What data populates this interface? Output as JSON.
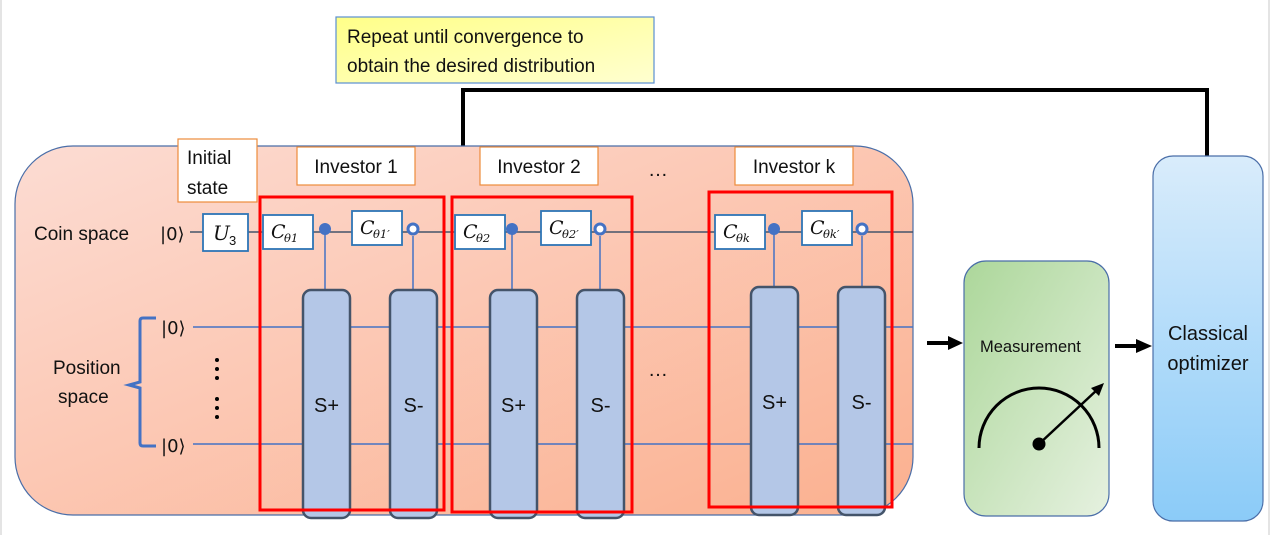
{
  "note": {
    "line1": "Repeat until convergence to",
    "line2": "obtain the desired distribution"
  },
  "labels": {
    "initial_state_1": "Initial",
    "initial_state_2": "state",
    "coin_space": "Coin space",
    "position_space_1": "Position",
    "position_space_2": "space",
    "ket_zero": "|0⟩",
    "ellipsis": "…",
    "vdots": "⋮"
  },
  "initial_gate": {
    "main": "U",
    "sub": "3"
  },
  "investors": [
    {
      "label": "Investor 1",
      "gate_a": {
        "main": "C",
        "sub": "θ1"
      },
      "gate_b": {
        "main": "C",
        "sub": "θ1′"
      },
      "shift_plus": "S+",
      "shift_minus": "S-"
    },
    {
      "label": "Investor 2",
      "gate_a": {
        "main": "C",
        "sub": "θ2"
      },
      "gate_b": {
        "main": "C",
        "sub": "θ2′"
      },
      "shift_plus": "S+",
      "shift_minus": "S-"
    },
    {
      "label": "Investor k",
      "gate_a": {
        "main": "C",
        "sub": "θk"
      },
      "gate_b": {
        "main": "C",
        "sub": "θk′"
      },
      "shift_plus": "S+",
      "shift_minus": "S-"
    }
  ],
  "measurement": {
    "label": "Measurement"
  },
  "optimizer": {
    "line1": "Classical",
    "line2": "optimizer"
  },
  "colors": {
    "circuit_bg_start": "#fbd9cf",
    "circuit_bg_end": "#fbb393",
    "investor_frame": "#ff0000",
    "label_border": "#ed8b3b",
    "gate_border": "#2e75b6",
    "wire": "#4472c4",
    "shift_fill": "#b4c7e7",
    "shift_border": "#44546a",
    "measurement_start": "#b3d9a0",
    "measurement_end": "#e2efda",
    "optimizer_start": "#d6eafb",
    "optimizer_end": "#8ecdf9",
    "note_fill": "#ffff99"
  }
}
